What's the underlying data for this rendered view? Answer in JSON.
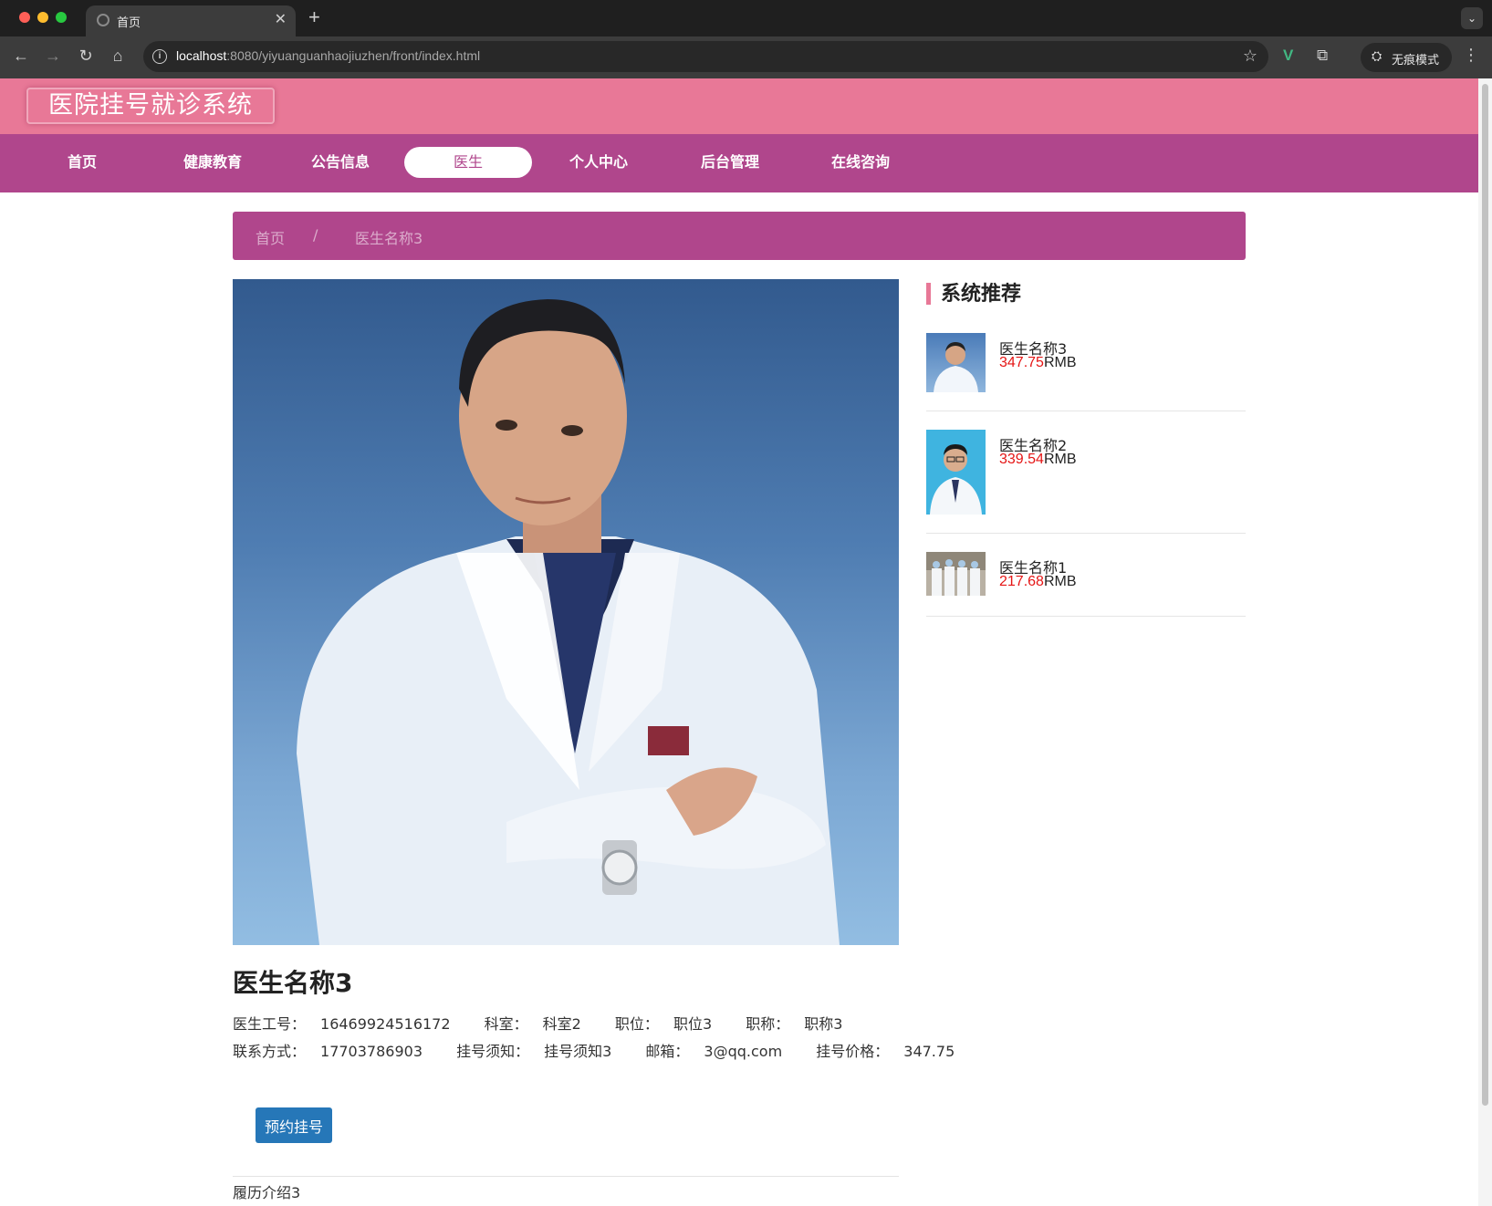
{
  "browser": {
    "tab_title": "首页",
    "url_host": "localhost",
    "url_path": ":8080/yiyuanguanhaojiuzhen/front/index.html",
    "incognito_label": "无痕模式"
  },
  "site": {
    "title": "医院挂号就诊系统"
  },
  "nav": {
    "items": [
      {
        "label": "首页"
      },
      {
        "label": "健康教育"
      },
      {
        "label": "公告信息"
      },
      {
        "label": "医生"
      },
      {
        "label": "个人中心"
      },
      {
        "label": "后台管理"
      },
      {
        "label": "在线咨询"
      }
    ],
    "active_index": 3
  },
  "breadcrumb": {
    "home": "首页",
    "separator": "/",
    "current": "医生名称3"
  },
  "doctor": {
    "name": "医生名称3",
    "fields_line1": [
      {
        "label": "医生工号：",
        "value": "16469924516172"
      },
      {
        "label": "科室：",
        "value": "科室2"
      },
      {
        "label": "职位：",
        "value": "职位3"
      },
      {
        "label": "职称：",
        "value": "职称3"
      }
    ],
    "fields_line2": [
      {
        "label": "联系方式：",
        "value": "17703786903"
      },
      {
        "label": "挂号须知：",
        "value": "挂号须知3"
      },
      {
        "label": "邮箱：",
        "value": "3@qq.com"
      },
      {
        "label": "挂号价格：",
        "value": "347.75"
      }
    ],
    "book_button": "预约挂号",
    "intro": "履历介绍3"
  },
  "recommend": {
    "title": "系统推荐",
    "items": [
      {
        "name": "医生名称3",
        "price": "347.75",
        "unit": "RMB"
      },
      {
        "name": "医生名称2",
        "price": "339.54",
        "unit": "RMB"
      },
      {
        "name": "医生名称1",
        "price": "217.68",
        "unit": "RMB"
      }
    ]
  },
  "colors": {
    "header": "#e87897",
    "nav": "#b0468c",
    "button": "#2677b8",
    "price": "#e51515"
  }
}
